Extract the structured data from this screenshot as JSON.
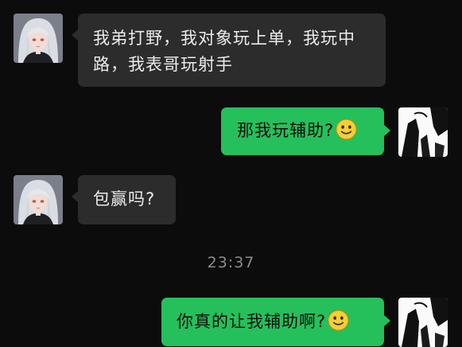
{
  "messages": [
    {
      "side": "in",
      "text": "我弟打野，我对象玩上单，我玩中路，我表哥玩射手"
    },
    {
      "side": "out",
      "text": "那我玩辅助?",
      "emoji": "smiling-face-icon"
    },
    {
      "side": "in",
      "text": "包赢吗?"
    },
    {
      "side": "out",
      "text": "你真的让我辅助啊?",
      "emoji": "smiling-face-icon"
    }
  ],
  "timestamp": "23:37",
  "colors": {
    "background": "#0c0c0c",
    "incoming_bubble": "#2c2c2c",
    "outgoing_bubble": "#25c05b",
    "timestamp": "#8c8c8c"
  }
}
